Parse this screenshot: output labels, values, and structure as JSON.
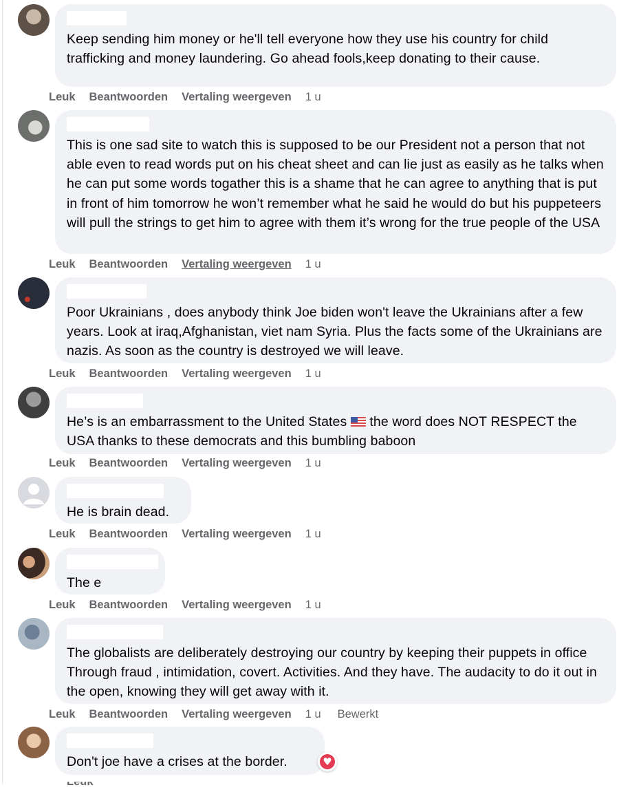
{
  "comments": [
    {
      "text": "Keep sending him money or he'll tell everyone how they use his country for child trafficking and money laundering. Go ahead fools,keep donating to their cause.",
      "time": "1 u"
    },
    {
      "text": "This is one sad site to watch this is supposed to be our President not a person that not able even to read words put on his cheat sheet and can lie just as easily as he talks when he can put some words togather this is a shame that he can agree to anything that is put in front of him tomorrow he won’t remember what he said he would do but his puppeteers will pull the strings to get him to agree with them it’s wrong for the true people of the USA",
      "time": "1 u"
    },
    {
      "text": "Poor Ukrainians , does anybody think Joe biden won't leave the Ukrainians after a few years. Look at iraq,Afghanistan, viet nam Syria. Plus the facts some of the Ukrainians are nazis. As soon as the country is destroyed we will leave.",
      "time": "1 u"
    },
    {
      "text_before": "He’s is an embarrassment to the United States",
      "text_after": "the word does NOT RESPECT the USA thanks to these democrats and this bumbling baboon",
      "time": "1 u"
    },
    {
      "text": "He is brain dead.",
      "time": "1 u"
    },
    {
      "text": "The e",
      "time": "1 u"
    },
    {
      "text": "The globalists are deliberately destroying our country by keeping their puppets in office Through fraud , intimidation, covert. Activities. And they have. The audacity to do it out in the open, knowing they will get away with it.",
      "time": "1 u",
      "edited": "Bewerkt"
    },
    {
      "text": "Don't joe have a crises at the border.",
      "reaction_icon": "heart-reaction-icon"
    }
  ],
  "labels": {
    "like": "Leuk",
    "reply": "Beantwoorden",
    "translate": "Vertaling weergeven"
  },
  "colors": {
    "bubble": "#f0f2f5",
    "action_text": "#65676b",
    "heart": "#e43a53"
  }
}
